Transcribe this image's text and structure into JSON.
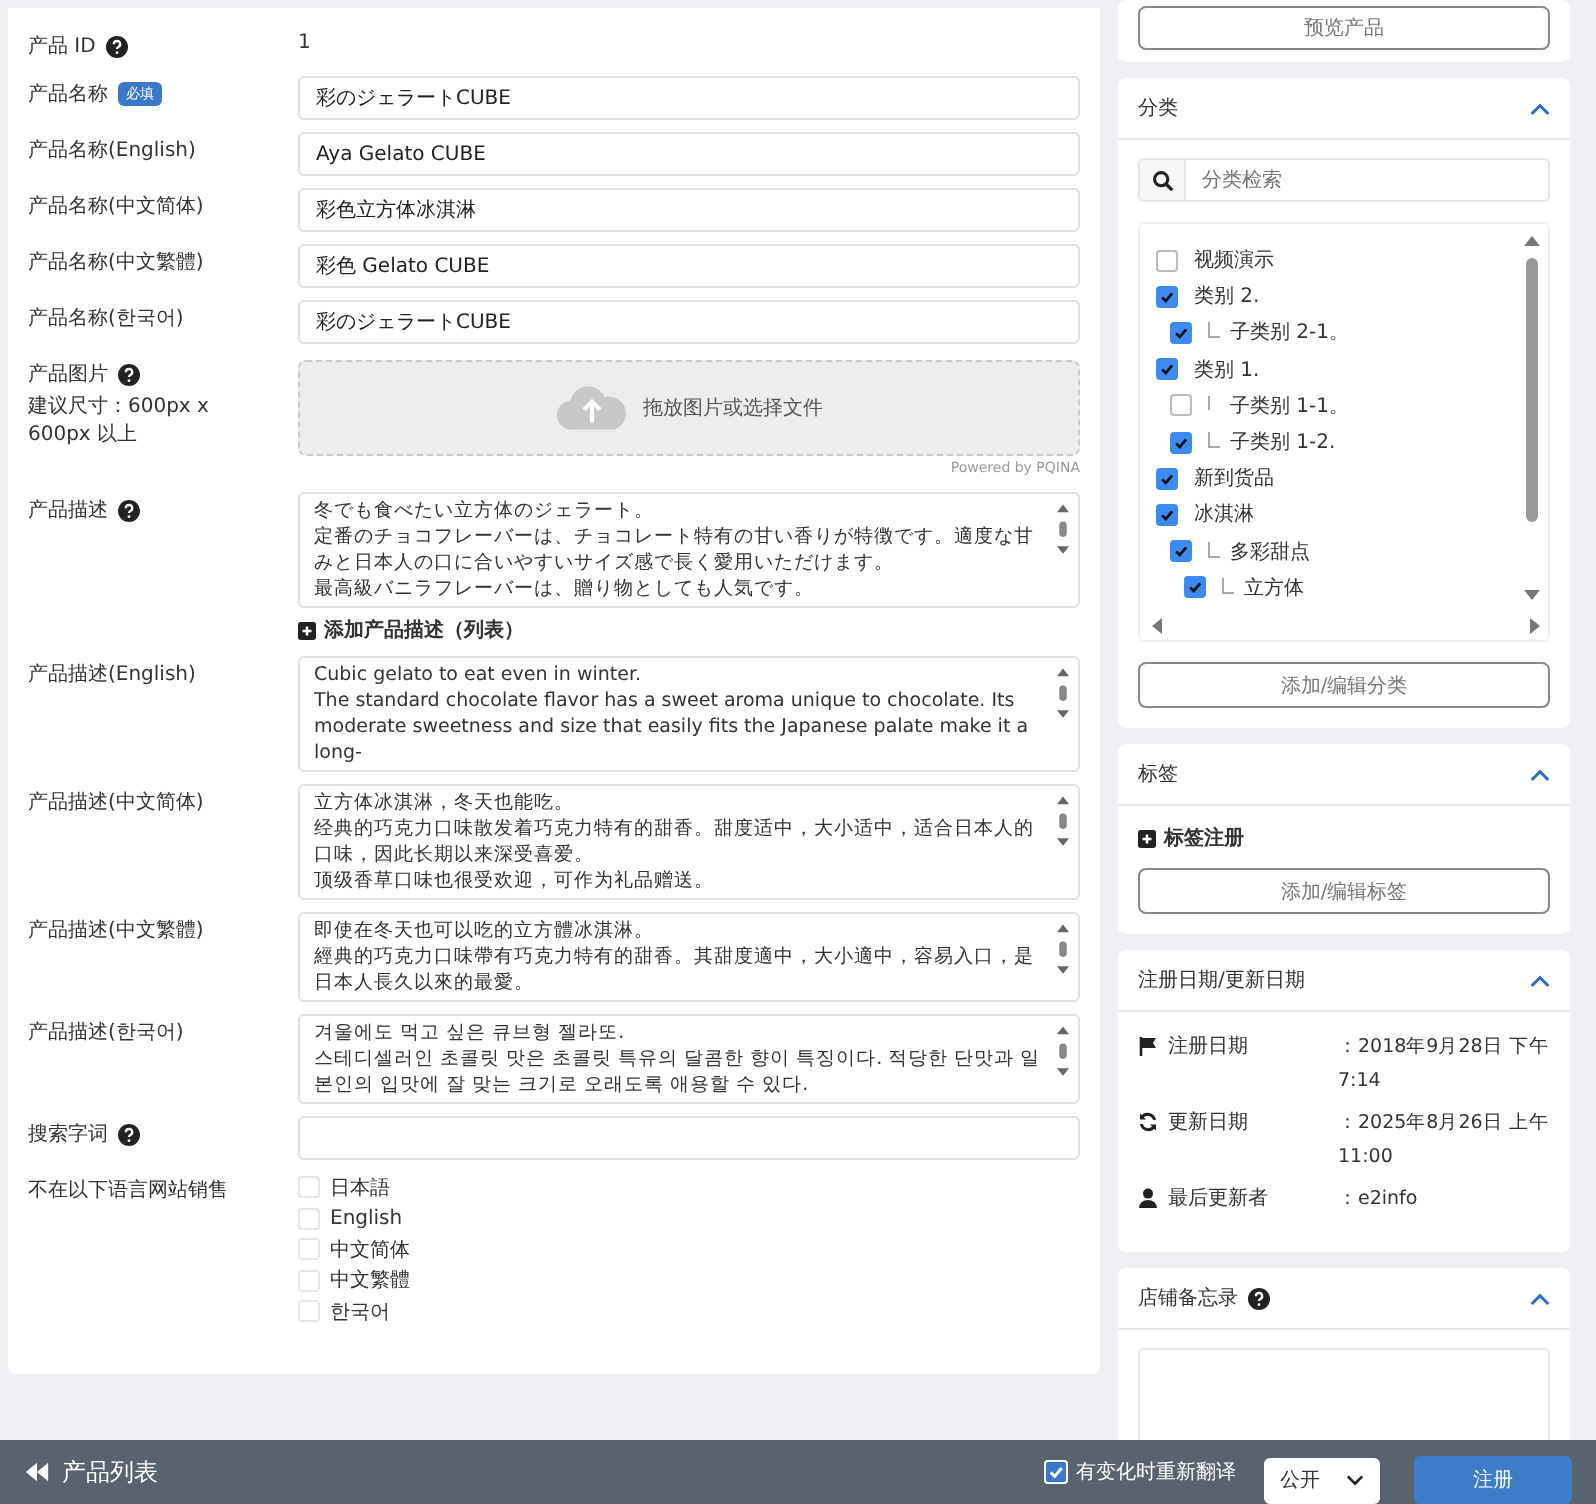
{
  "product_form": {
    "fields": [
      {
        "kind": "text",
        "label": "产品 ID",
        "help": true,
        "value": "1"
      },
      {
        "kind": "input",
        "label": "产品名称",
        "badge": "必填",
        "value": "彩のジェラートCUBE"
      },
      {
        "kind": "input",
        "label": "产品名称(English)",
        "value": "Aya Gelato CUBE"
      },
      {
        "kind": "input",
        "label": "产品名称(中文简体)",
        "value": "彩色立方体冰淇淋"
      },
      {
        "kind": "input",
        "label": "产品名称(中文繁體)",
        "value": "彩色 Gelato CUBE"
      },
      {
        "kind": "input",
        "label": "产品名称(한국어)",
        "value": "彩のジェラートCUBE"
      },
      {
        "kind": "upload",
        "label": "产品图片",
        "help": true,
        "hint": "建议尺寸：600px x 600px 以上",
        "value": "拖放图片或选择文件",
        "credit": "Powered by PQINA"
      },
      {
        "kind": "textarea",
        "label": "产品描述",
        "help": true,
        "lines": [
          "冬でも食べたい立方体のジェラート。",
          "定番のチョコフレーバーは、チョコレート特有の甘い香りが特徴です。適度な甘みと日本人の口に合いやすいサイズ感で長く愛用いただけます。",
          "最高級バニラフレーバーは、贈り物としても人気です。"
        ],
        "add_link": "添加产品描述（列表）"
      },
      {
        "kind": "textarea",
        "label": "产品描述(English)",
        "lines": [
          "Cubic gelato to eat even in winter.",
          "The standard chocolate flavor has a sweet aroma unique to chocolate. Its moderate sweetness and size that easily fits the Japanese palate make it a long-"
        ]
      },
      {
        "kind": "textarea",
        "label": "产品描述(中文简体)",
        "lines": [
          "立方体冰淇淋，冬天也能吃。",
          "经典的巧克力口味散发着巧克力特有的甜香。甜度适中，大小适中，适合日本人的口味，因此长期以来深受喜爱。",
          "顶级香草口味也很受欢迎，可作为礼品赠送。"
        ]
      },
      {
        "kind": "textarea",
        "label": "产品描述(中文繁體)",
        "lines": [
          "即使在冬天也可以吃的立方體冰淇淋。",
          "經典的巧克力口味帶有巧克力特有的甜香。其甜度適中，大小適中，容易入口，是日本人長久以來的最愛。"
        ]
      },
      {
        "kind": "textarea",
        "label": "产品描述(한국어)",
        "lines": [
          "겨울에도 먹고 싶은 큐브형 젤라또.",
          "스테디셀러인 초콜릿 맛은 초콜릿 특유의 달콤한 향이 특징이다. 적당한 단맛과 일본인의 입맛에 잘 맞는 크기로 오래도록 애용할 수 있다."
        ]
      },
      {
        "kind": "input",
        "label": "搜索字词",
        "help": true
      },
      {
        "kind": "checkboxes",
        "label": "不在以下语言网站销售",
        "options": [
          {
            "label": "日本語",
            "checked": false
          },
          {
            "label": "English",
            "checked": false
          },
          {
            "label": "中文简体",
            "checked": false
          },
          {
            "label": "中文繁體",
            "checked": false
          },
          {
            "label": "한국어",
            "checked": false
          }
        ]
      }
    ]
  },
  "sidebar": {
    "preview_button": "预览产品",
    "category_panel": {
      "title": "分类",
      "search_placeholder": "分类检索",
      "tree": [
        {
          "label": "视频演示",
          "checked": false
        },
        {
          "label": "类别 2.",
          "checked": true,
          "children": [
            {
              "label": "子类别 2-1。",
              "checked": true
            }
          ]
        },
        {
          "label": "类别 1.",
          "checked": true,
          "children": [
            {
              "label": "子类别 1-1。",
              "checked": false
            },
            {
              "label": "子类别 1-2.",
              "checked": true
            }
          ]
        },
        {
          "label": "新到货品",
          "checked": true
        },
        {
          "label": "冰淇淋",
          "checked": true,
          "children": [
            {
              "label": "多彩甜点",
              "checked": true,
              "children": [
                {
                  "label": "立方体",
                  "checked": true
                }
              ]
            }
          ]
        }
      ],
      "button": "添加/编辑分类"
    },
    "tag_panel": {
      "title": "标签",
      "add_link": "标签注册",
      "button": "添加/编辑标签"
    },
    "date_panel": {
      "title": "注册日期/更新日期",
      "rows": [
        {
          "kind": "registered",
          "label": "注册日期",
          "value": "：2018年9月28日 下午7:14"
        },
        {
          "kind": "updated",
          "label": "更新日期",
          "value": "：2025年8月26日 上午11:00"
        },
        {
          "kind": "updater",
          "label": "最后更新者",
          "value": "：e2info"
        }
      ]
    },
    "memo_panel": {
      "title": "店铺备忘录",
      "help": true
    }
  },
  "footer": {
    "back_link": "产品列表",
    "retranslate": {
      "label": "有变化时重新翻译",
      "checked": true
    },
    "visibility": "公开",
    "submit": "注册"
  }
}
